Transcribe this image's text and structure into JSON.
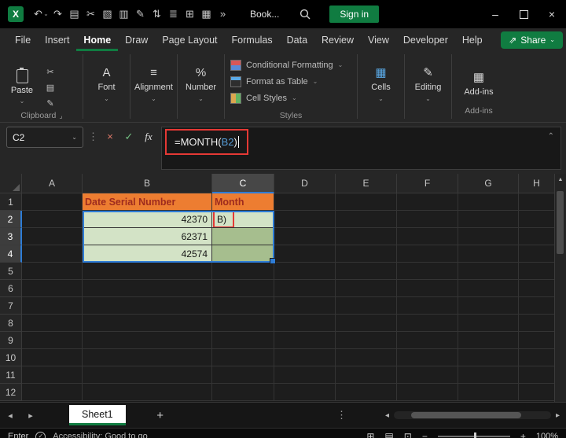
{
  "colors": {
    "accent_green": "#107C41",
    "selection_blue": "#2E7CD6",
    "header_fill_orange": "#ED7D31",
    "header_text_red": "#9E2B1E",
    "cell_light_green": "#D3E3C6",
    "cell_mid_green": "#A6BE8E",
    "highlight_red": "#E53935",
    "formula_ref_blue": "#569CD6"
  },
  "titlebar": {
    "workbook_name": "Book...",
    "signin_label": "Sign in",
    "quick_icons": [
      {
        "name": "undo-icon",
        "glyph": "↶"
      },
      {
        "name": "undo-dropdown-icon",
        "glyph": "⌄"
      },
      {
        "name": "redo-icon",
        "glyph": "↷"
      },
      {
        "name": "copy-icon",
        "glyph": "▤"
      },
      {
        "name": "cut-icon",
        "glyph": "✂"
      },
      {
        "name": "picture-icon",
        "glyph": "▧"
      },
      {
        "name": "chart-icon",
        "glyph": "▥"
      },
      {
        "name": "format-painter-icon",
        "glyph": "✎"
      },
      {
        "name": "sort-icon",
        "glyph": "⇅"
      },
      {
        "name": "print-icon",
        "glyph": "≣"
      },
      {
        "name": "borders-icon",
        "glyph": "⊞"
      },
      {
        "name": "table-icon",
        "glyph": "▦"
      },
      {
        "name": "more-commands-icon",
        "glyph": "»"
      }
    ]
  },
  "menu": {
    "items": [
      {
        "label": "File"
      },
      {
        "label": "Insert"
      },
      {
        "label": "Home",
        "active": true
      },
      {
        "label": "Draw"
      },
      {
        "label": "Page Layout"
      },
      {
        "label": "Formulas"
      },
      {
        "label": "Data"
      },
      {
        "label": "Review"
      },
      {
        "label": "View"
      },
      {
        "label": "Developer"
      },
      {
        "label": "Help"
      }
    ],
    "share_label": "Share"
  },
  "ribbon": {
    "paste_label": "Paste",
    "clipboard_group_label": "Clipboard",
    "clipboard_tools": [
      {
        "name": "cut-icon",
        "glyph": "✂"
      },
      {
        "name": "copy-icon",
        "glyph": "▤"
      },
      {
        "name": "format-painter-icon",
        "glyph": "✎"
      }
    ],
    "collapsed_left": [
      {
        "label": "Font",
        "glyph": "A"
      },
      {
        "label": "Alignment",
        "glyph": "≡"
      },
      {
        "label": "Number",
        "glyph": "%"
      }
    ],
    "styles_group": {
      "label": "Styles",
      "items": [
        {
          "label": "Conditional Formatting"
        },
        {
          "label": "Format as Table"
        },
        {
          "label": "Cell Styles"
        }
      ]
    },
    "collapsed_right": [
      {
        "label": "Cells",
        "glyph": "▦"
      },
      {
        "label": "Editing",
        "glyph": "✎"
      }
    ],
    "addins_label": "Add-ins"
  },
  "formula_bar": {
    "cell_reference": "C2",
    "formula": {
      "prefix": "=MONTH(",
      "reference": "B2",
      "suffix": ")"
    }
  },
  "grid": {
    "columns": [
      "A",
      "B",
      "C",
      "D",
      "E",
      "F",
      "G",
      "H"
    ],
    "rows": [
      "1",
      "2",
      "3",
      "4",
      "5",
      "6",
      "7",
      "8",
      "9",
      "10",
      "11",
      "12"
    ],
    "selected_column": "C",
    "selected_rows": [
      "2",
      "3",
      "4"
    ],
    "cells": {
      "B1": {
        "text": "Date Serial Number",
        "style": "hdr"
      },
      "C1": {
        "text": "Month",
        "style": "hdr"
      },
      "B2": {
        "text": "42370",
        "style": "lightgreen num"
      },
      "B3": {
        "text": "62371",
        "style": "lightgreen num"
      },
      "B4": {
        "text": "42574",
        "style": "lightgreen num"
      },
      "C2": {
        "text": "B)",
        "style": "lightgreen edit"
      },
      "C3": {
        "text": "",
        "style": "midgreen"
      },
      "C4": {
        "text": "",
        "style": "midgreen"
      }
    }
  },
  "sheet": {
    "tabs": [
      "Sheet1"
    ],
    "active_tab": "Sheet1"
  },
  "status": {
    "mode": "Enter",
    "accessibility": "Accessibility: Good to go",
    "zoom": "100%"
  }
}
